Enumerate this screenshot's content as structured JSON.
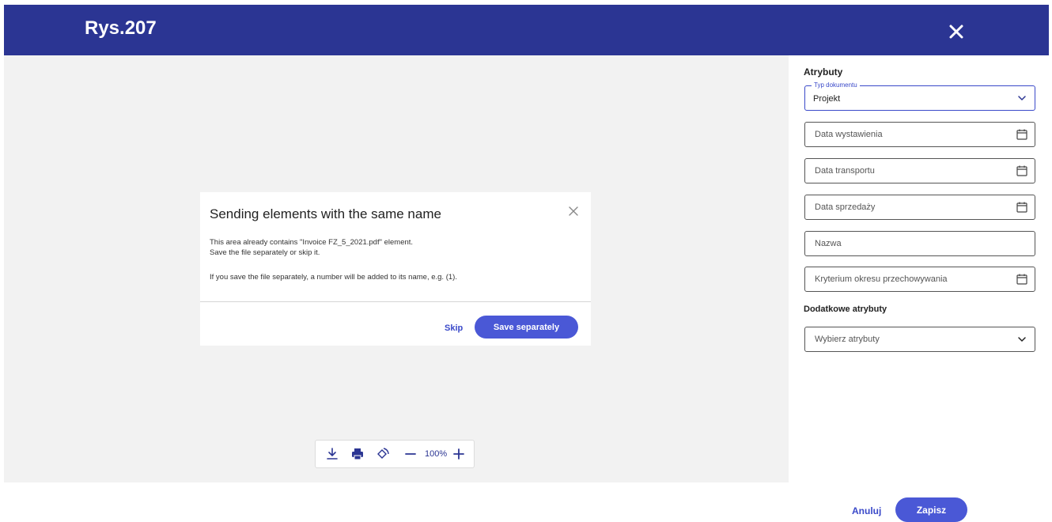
{
  "header": {
    "title": "Rys.207",
    "close_icon": "close-icon"
  },
  "dialog": {
    "title": "Sending elements with the same name",
    "line1": "This area already contains \"Invoice FZ_5_2021.pdf\" element.",
    "line2": "Save the file separately or skip it.",
    "line3": "If you save the file separately, a number will be added to its name, e.g. (1).",
    "skip_label": "Skip",
    "save_separately_label": "Save separately"
  },
  "toolbar": {
    "icons": [
      "download-icon",
      "print-icon",
      "rotate-icon",
      "zoom-out-icon",
      "zoom-in-icon"
    ],
    "zoom": "100%"
  },
  "attributes": {
    "title": "Atrybuty",
    "doc_type": {
      "label": "Typ dokumentu",
      "value": "Projekt"
    },
    "issue_date": {
      "placeholder": "Data wystawienia"
    },
    "transport_date": {
      "placeholder": "Data transportu"
    },
    "sale_date": {
      "placeholder": "Data sprzedaży"
    },
    "name": {
      "placeholder": "Nazwa"
    },
    "retention": {
      "placeholder": "Kryterium okresu przechowywania"
    },
    "additional_title": "Dodatkowe atrybuty",
    "additional_select": {
      "placeholder": "Wybierz atrybuty"
    }
  },
  "footer": {
    "cancel_label": "Anuluj",
    "save_label": "Zapisz"
  },
  "colors": {
    "header": "#2b3593",
    "accent": "#4a58d6",
    "link": "#3a49c9"
  }
}
